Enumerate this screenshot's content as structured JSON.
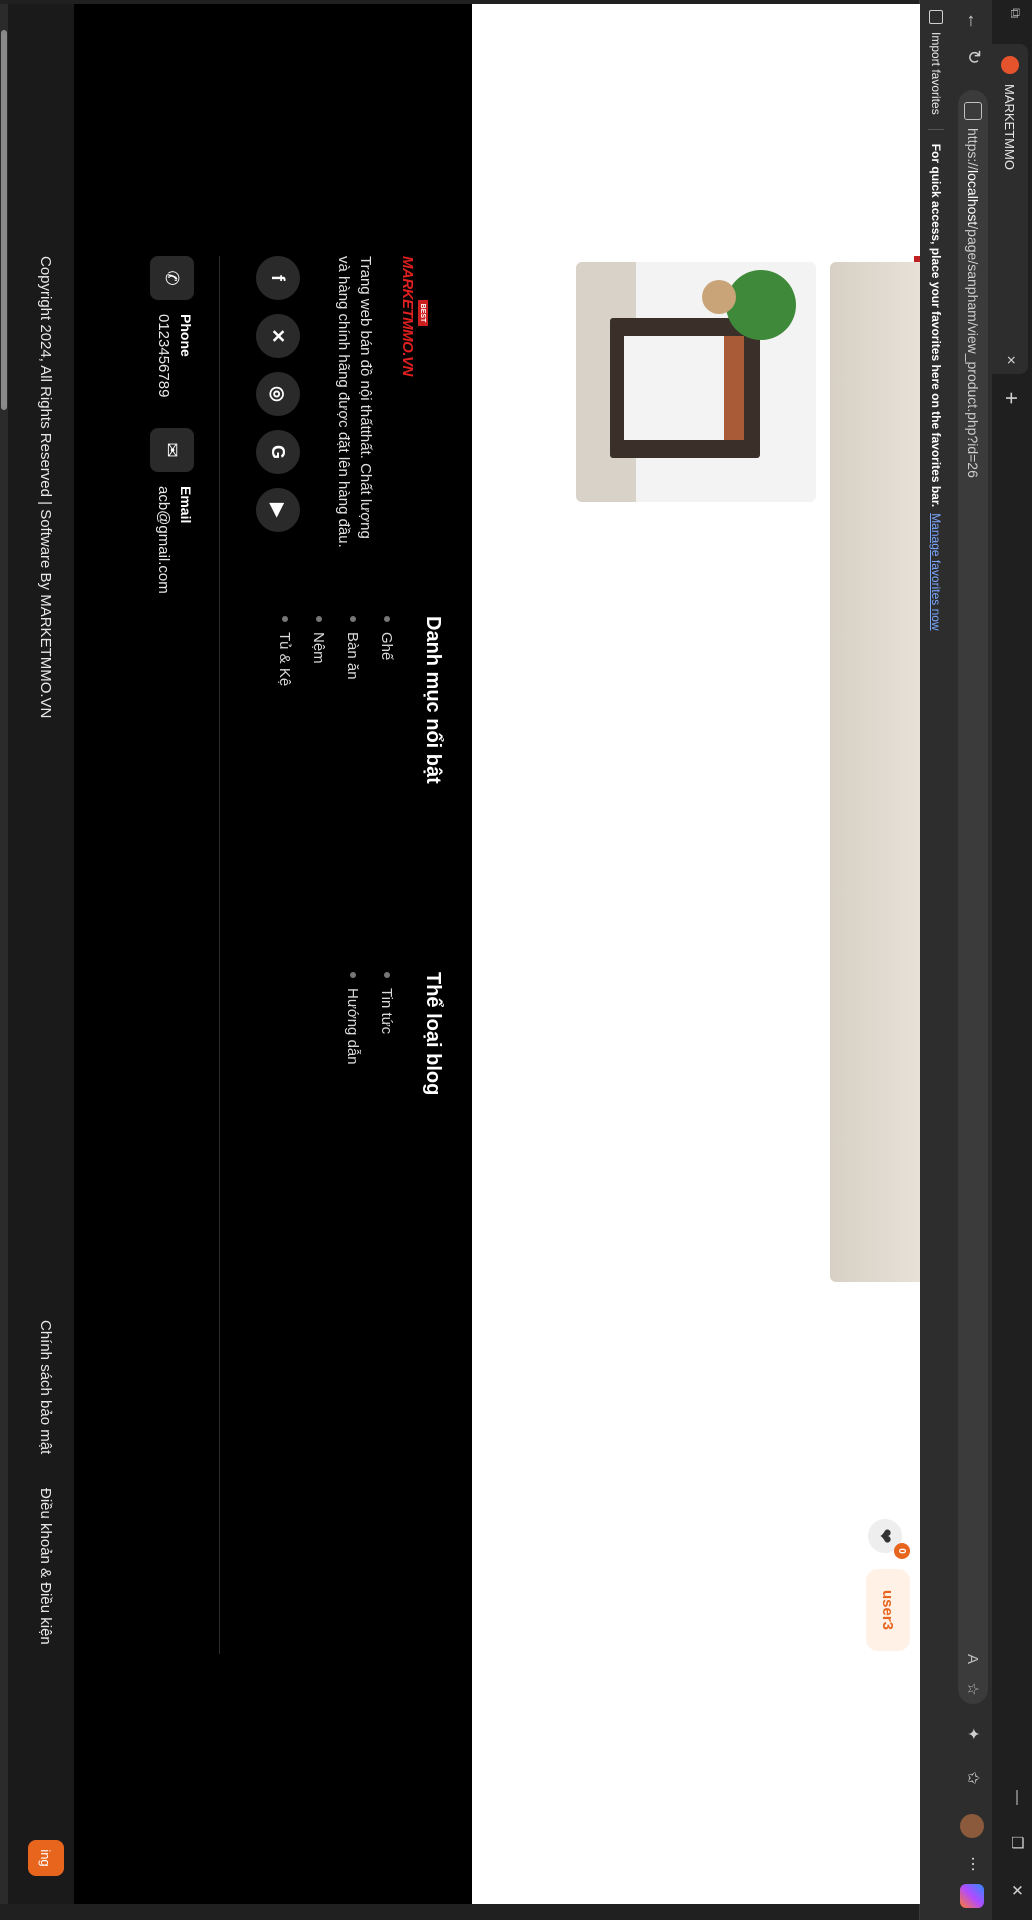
{
  "browser": {
    "tab_title": "MARKETMMO",
    "tab_close": "×",
    "new_tab": "+",
    "url_prefix": "https://",
    "url_host": "localhost",
    "url_path": "/page/sanpham/view_product.php?id=26",
    "favorites_import": "Import favorites",
    "favorites_message": "For quick access, place your favorites here on the favorites bar.",
    "favorites_link": "Manage favorites now"
  },
  "header": {
    "user_label": "user3",
    "wishlist_count": "0"
  },
  "footer": {
    "logo_badge": "BEST",
    "logo_text": "MARKETMMO.VN",
    "about": "Trang web bán đồ nội thấtthất. Chất lượng và hàng chính hãng được đặt lên hàng đầu.",
    "featured_title": "Danh mục nổi bật",
    "featured_items": [
      {
        "label": "Ghế"
      },
      {
        "label": "Bàn ăn"
      },
      {
        "label": "Nệm"
      },
      {
        "label": "Tủ & Kệ"
      }
    ],
    "blog_title": "Thể loại blog",
    "blog_items": [
      {
        "label": "Tin tức"
      },
      {
        "label": "Hướng dẫn"
      }
    ],
    "phone_label": "Phone",
    "phone_value": "0123456789",
    "email_label": "Email",
    "email_value": "acb@gmail.com",
    "copyright": "Copyright 2024, All Rights Reserved | Software By MARKETMMO.VN",
    "privacy": "Chính sách bảo mật",
    "terms": "Điều khoản & Điều kiện",
    "floating_label": "ing"
  }
}
